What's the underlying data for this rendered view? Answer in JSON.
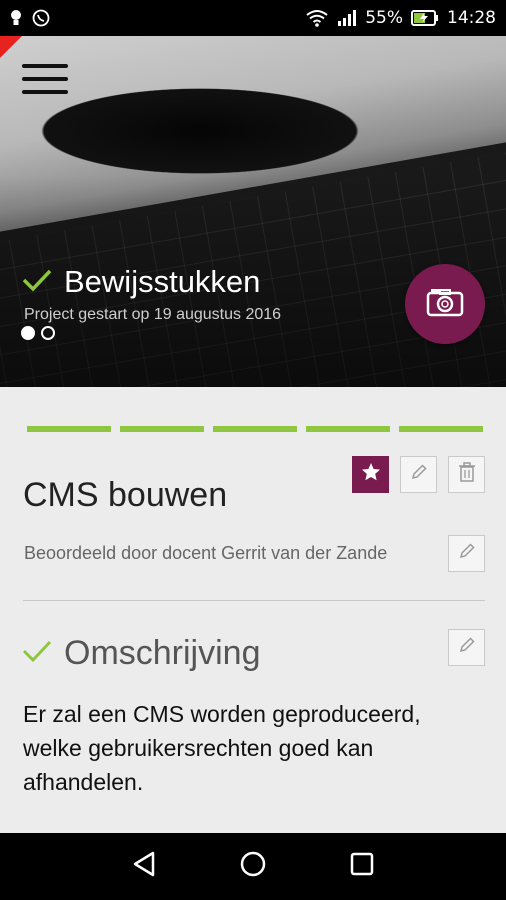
{
  "statusbar": {
    "battery": "55%",
    "time": "14:28",
    "icons": [
      "lightbulb-icon",
      "whatsapp-icon",
      "wifi-icon",
      "signal-icon",
      "battery-charging-icon"
    ]
  },
  "hero": {
    "title": "Bewijsstukken",
    "subtitle": "Project gestart op 19 augustus 2016",
    "pager_count": 2,
    "pager_active": 0
  },
  "progress": {
    "segments": 5,
    "completed": 5,
    "color": "#8ec63f"
  },
  "item": {
    "title": "CMS bouwen",
    "graded_by": "Beoordeeld door docent Gerrit van der Zande"
  },
  "section": {
    "title": "Omschrijving",
    "description": "Er zal een CMS worden geproduceerd, welke gebruikersrechten goed kan afhandelen."
  },
  "colors": {
    "accent": "#7a1b4f",
    "check": "#8ec63f"
  }
}
